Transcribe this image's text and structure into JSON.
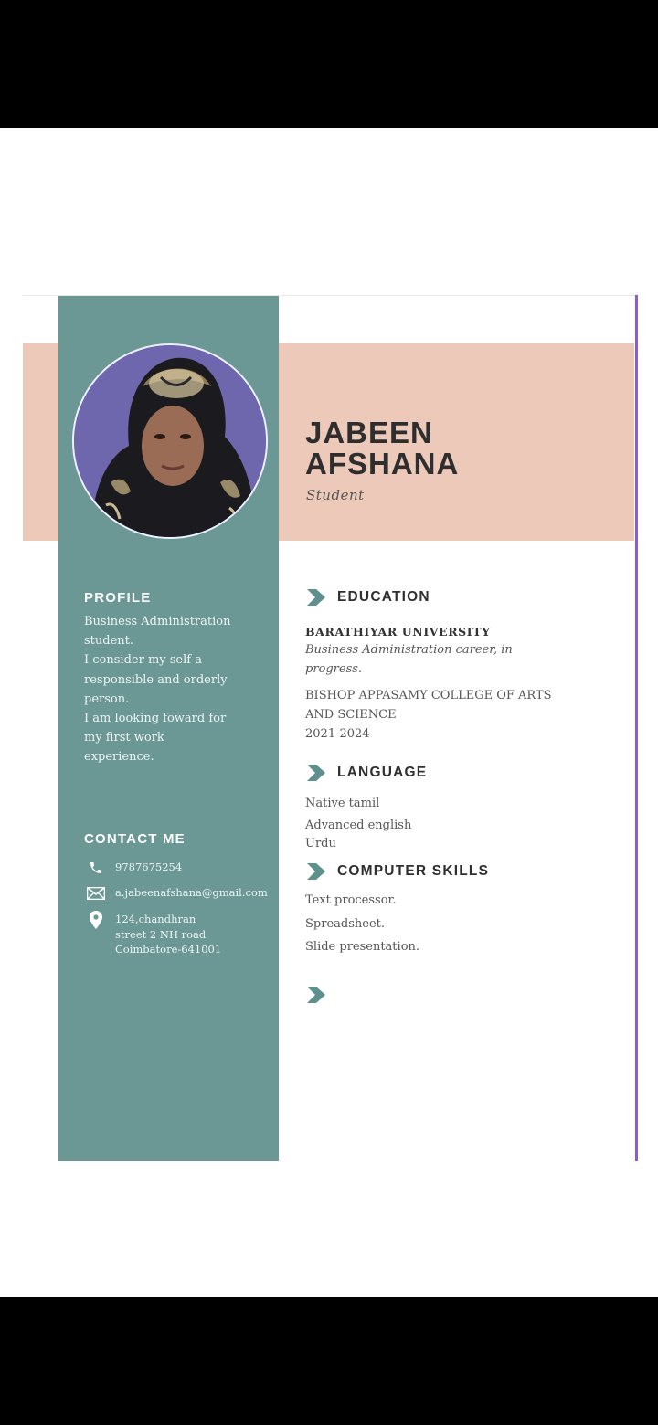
{
  "header": {
    "name_line1": "JABEEN",
    "name_line2": "AFSHANA",
    "role": "Student"
  },
  "profile": {
    "heading": "PROFILE",
    "lines": [
      "Business Administration",
      "student.",
      "I consider my self a",
      "responsible and orderly",
      "person.",
      "I am looking foward for",
      "my first work",
      "experience."
    ]
  },
  "contact": {
    "heading": "CONTACT ME",
    "phone": "9787675254",
    "email": "a.jabeenafshana@gmail.com",
    "address_line1": "124,chandhran",
    "address_line2": "street 2 NH road",
    "address_line3": "Coimbatore-641001",
    "icons": [
      "phone-icon",
      "mail-icon",
      "location-pin-icon"
    ]
  },
  "education": {
    "heading": "EDUCATION",
    "school1": "BARATHIYAR UNIVERSITY",
    "school1_detail_line1": "Business Administration career, in",
    "school1_detail_line2": "progress.",
    "school2_line1": "BISHOP APPASAMY COLLEGE OF ARTS",
    "school2_line2": "AND SCIENCE",
    "school2_years": "2021-2024"
  },
  "language": {
    "heading": "LANGUAGE",
    "items": [
      "Native tamil",
      "Advanced english",
      "Urdu"
    ]
  },
  "skills": {
    "heading": "COMPUTER SKILLS",
    "items": [
      "Text processor.",
      "Spreadsheet.",
      "Slide presentation."
    ]
  },
  "colors": {
    "sidebar": "#6b9895",
    "peach": "#ecc9b9",
    "accent_chevron": "#5e918d",
    "text_dark": "#2e2e2e"
  }
}
